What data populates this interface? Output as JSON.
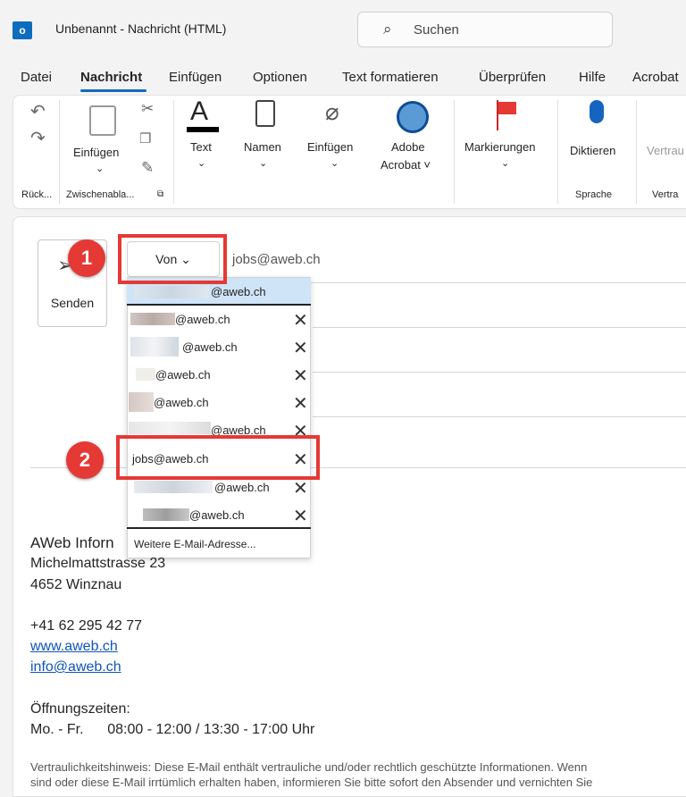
{
  "window": {
    "title": "Unbenannt  -  Nachricht (HTML)",
    "app_logo": "o"
  },
  "search": {
    "label": "Suchen",
    "icon": "search-icon"
  },
  "tabs": [
    "Datei",
    "Nachricht",
    "Einfügen",
    "Optionen",
    "Text formatieren",
    "Überprüfen",
    "Hilfe",
    "Acrobat"
  ],
  "active_tab": "Nachricht",
  "ribbon": {
    "paste": "Einfügen",
    "text": "Text",
    "names": "Namen",
    "insert": "Einfügen",
    "adobe_line1": "Adobe",
    "adobe_line2": "Acrobat ˅",
    "flags": "Markierungen",
    "dictate": "Diktieren",
    "confidential": "Vertrau",
    "group_undo": "Rück...",
    "group_clipboard": "Zwischenabla...",
    "group_speech": "Sprache",
    "group_confidential": "Vertra"
  },
  "compose": {
    "send_label": "Senden",
    "from_label": "Von  ⌄",
    "from_email": "jobs@aweb.ch"
  },
  "callouts": {
    "one": "1",
    "two": "2"
  },
  "dropdown": {
    "items": [
      {
        "text": "@aweb.ch",
        "selected": true
      },
      {
        "text": "@aweb.ch"
      },
      {
        "text": "@aweb.ch"
      },
      {
        "text": "@aweb.ch"
      },
      {
        "text": "@aweb.ch"
      },
      {
        "text": "@aweb.ch"
      },
      {
        "text": "jobs@aweb.ch"
      },
      {
        "text": "@aweb.ch"
      },
      {
        "text": "@aweb.ch"
      }
    ],
    "more": "Weitere E-Mail-Adresse..."
  },
  "signature": {
    "company": "AWeb Inforn",
    "street": "Michelmattstrasse 23",
    "city": "4652 Winznau",
    "phone": "+41 62 295 42 77",
    "web": "www.aweb.ch",
    "mail": "info@aweb.ch",
    "hours_title": "Öffnungszeiten:",
    "hours": "Mo. - Fr.      08:00 - 12:00 / 13:30 - 17:00 Uhr",
    "disclaimer1": "Vertraulichkeitshinweis: Diese E-Mail enthält vertrauliche und/oder rechtlich geschützte Informationen. Wenn",
    "disclaimer2": "sind oder diese E-Mail irrtümlich erhalten haben, informieren Sie bitte sofort den Absender und vernichten Sie"
  },
  "colors": {
    "accent": "#0f6cbd",
    "callout": "#e53935"
  }
}
